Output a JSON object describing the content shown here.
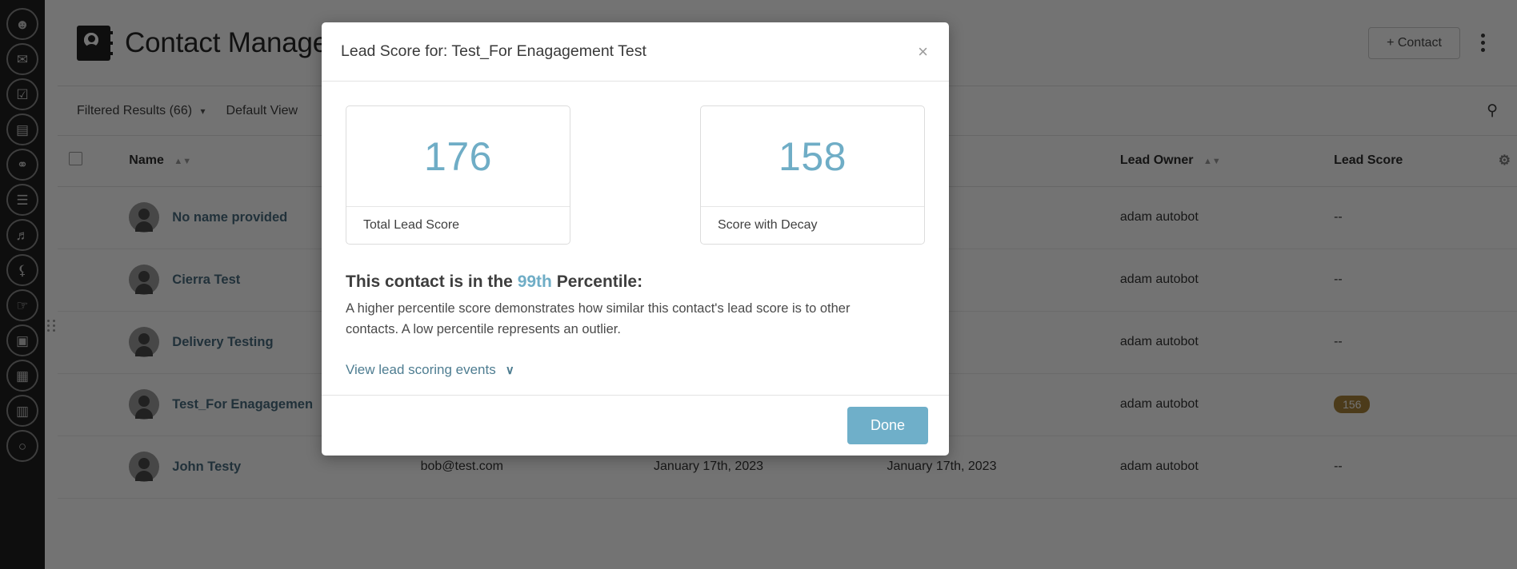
{
  "app": {
    "rail": {
      "items": [
        {
          "name": "contacts-icon",
          "glyph": "☺"
        },
        {
          "name": "email-icon",
          "glyph": "✉"
        },
        {
          "name": "clipboard-icon",
          "glyph": "☑"
        },
        {
          "name": "book-icon",
          "glyph": "▤"
        },
        {
          "name": "workflow-icon",
          "glyph": "⚭"
        },
        {
          "name": "list-icon",
          "glyph": "☰"
        },
        {
          "name": "megaphone-icon",
          "glyph": "὎3"
        },
        {
          "name": "shield-icon",
          "glyph": "⛨"
        },
        {
          "name": "thumbs-up-icon",
          "glyph": "☝"
        },
        {
          "name": "briefcase-icon",
          "glyph": "▣"
        },
        {
          "name": "image-icon",
          "glyph": "▦"
        },
        {
          "name": "notes-icon",
          "glyph": "▥"
        },
        {
          "name": "more-icon",
          "glyph": "○"
        }
      ]
    },
    "header": {
      "title": "Contact Manager",
      "add_contact_label": "+ Contact"
    },
    "subbar": {
      "filtered_results": "Filtered Results (66)",
      "default_view": "Default View"
    },
    "table": {
      "columns": [
        {
          "key": "check",
          "label": ""
        },
        {
          "key": "name",
          "label": "Name",
          "sortable": true
        },
        {
          "key": "email",
          "label": ""
        },
        {
          "key": "date1",
          "label": ""
        },
        {
          "key": "date2",
          "label": ""
        },
        {
          "key": "owner",
          "label": "Lead Owner",
          "sortable": true
        },
        {
          "key": "score",
          "label": "Lead Score",
          "sortable": false
        }
      ],
      "rows": [
        {
          "name": "No name provided",
          "email": "",
          "date1": "",
          "date2": "",
          "owner": "adam autobot",
          "score": "--"
        },
        {
          "name": "Cierra Test",
          "email": "",
          "date1": "",
          "date2": "",
          "owner": "adam autobot",
          "score": "--"
        },
        {
          "name": "Delivery Testing",
          "email": "",
          "date1": "",
          "date2": "",
          "owner": "adam autobot",
          "score": "--"
        },
        {
          "name": "Test_For Enagagemen",
          "email": "",
          "date1": "",
          "date2": "",
          "owner": "adam autobot",
          "score": "156"
        },
        {
          "name": "John Testy",
          "email": "bob@test.com",
          "date1": "January 17th, 2023",
          "date2": "January 17th, 2023",
          "owner": "adam autobot",
          "score": "--"
        }
      ]
    }
  },
  "modal": {
    "title": "Lead Score for: Test_For Enagagement Test",
    "close_label": "×",
    "cards": [
      {
        "value": "176",
        "label": "Total Lead Score"
      },
      {
        "value": "158",
        "label": "Score with Decay"
      }
    ],
    "percentile": {
      "prefix": "This contact is in the ",
      "value": "99th",
      "suffix": " Percentile:",
      "description": "A higher percentile score demonstrates how similar this contact's lead score is to other contacts. A low percentile represents an outlier."
    },
    "events_link": {
      "label": "View lead scoring events",
      "chevron": "∨"
    },
    "done_label": "Done"
  },
  "colors": {
    "accent_blue": "#6fafc9",
    "score_blue": "#6fadc6",
    "link_teal": "#4e7d91",
    "score_pill": "#a8833a"
  }
}
